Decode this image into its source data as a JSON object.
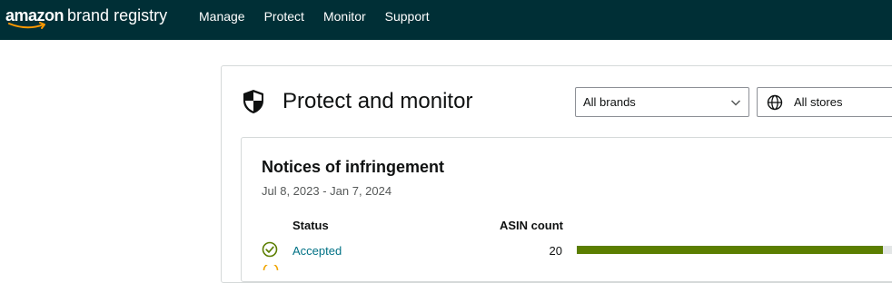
{
  "header": {
    "logo_text_1": "amazon",
    "logo_text_2": "brand registry",
    "nav": [
      "Manage",
      "Protect",
      "Monitor",
      "Support"
    ]
  },
  "page": {
    "title": "Protect and monitor",
    "brand_select": "All brands",
    "store_select": "All stores"
  },
  "card": {
    "title": "Notices of infringement",
    "date_range": "Jul 8, 2023 - Jan 7, 2024",
    "columns": {
      "status": "Status",
      "asin_count": "ASIN count"
    },
    "rows": [
      {
        "status": "Accepted",
        "count": "20",
        "fill_fraction": 0.97
      }
    ]
  },
  "colors": {
    "topbar": "#002f36",
    "link": "#007185",
    "bar_fill": "#5b7e00",
    "bar_track": "#e3e6e6"
  }
}
